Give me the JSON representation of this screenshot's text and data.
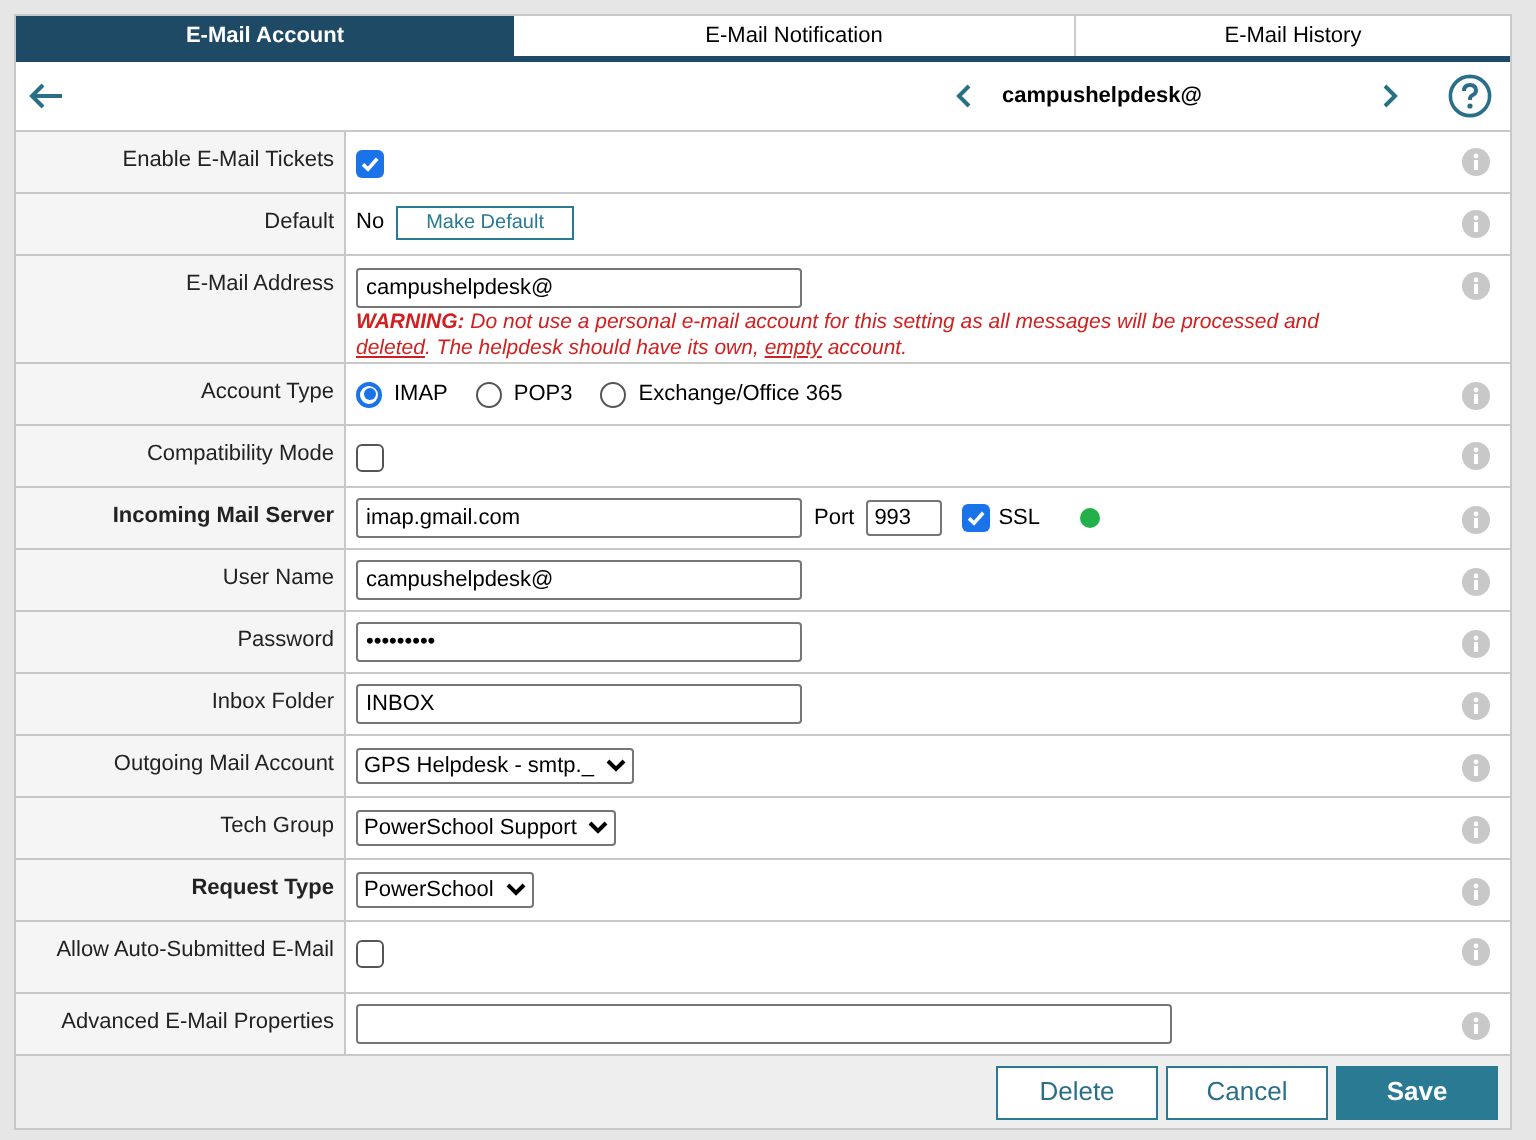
{
  "tabs": [
    {
      "label": "E-Mail Account",
      "selected": true
    },
    {
      "label": "E-Mail Notification",
      "selected": false
    },
    {
      "label": "E-Mail History",
      "selected": false
    }
  ],
  "header": {
    "title": "campushelpdesk@"
  },
  "rows": [
    {
      "kind": "checkbox",
      "label": "Enable E-Mail Tickets",
      "bold": false,
      "checked": true
    },
    {
      "kind": "default",
      "label": "Default",
      "bold": false,
      "value": "No",
      "button": "Make Default"
    },
    {
      "kind": "input",
      "label": "E-Mail Address",
      "bold": false,
      "value": "campushelpdesk@",
      "warning": [
        {
          "text": "WARNING:",
          "kind": "strong"
        },
        {
          "text": " Do not use a personal e-mail account for this setting as all messages will be processed and ",
          "kind": "plain"
        },
        {
          "text": "deleted",
          "kind": "underline"
        },
        {
          "text": ". The helpdesk should have its own, ",
          "kind": "plain"
        },
        {
          "text": "empty",
          "kind": "underline"
        },
        {
          "text": " account.",
          "kind": "plain"
        }
      ]
    },
    {
      "kind": "radio",
      "label": "Account Type",
      "bold": false,
      "options": [
        {
          "label": "IMAP",
          "selected": true
        },
        {
          "label": "POP3",
          "selected": false
        },
        {
          "label": "Exchange/Office 365",
          "selected": false
        }
      ]
    },
    {
      "kind": "checkbox",
      "label": "Compatibility Mode",
      "bold": false,
      "checked": false
    },
    {
      "kind": "server",
      "label": "Incoming Mail Server",
      "bold": true,
      "value": "imap.gmail.com",
      "port_label": "Port",
      "port": "993",
      "ssl_label": "SSL",
      "ssl": true,
      "connected": true
    },
    {
      "kind": "input",
      "label": "User Name",
      "bold": false,
      "value": "campushelpdesk@"
    },
    {
      "kind": "input",
      "label": "Password",
      "bold": false,
      "value": "•••••••••"
    },
    {
      "kind": "input",
      "label": "Inbox Folder",
      "bold": false,
      "value": "INBOX"
    },
    {
      "kind": "select",
      "label": "Outgoing Mail Account",
      "bold": false,
      "value": "GPS Helpdesk - smtp._"
    },
    {
      "kind": "select",
      "label": "Tech Group",
      "bold": false,
      "value": "PowerSchool Support"
    },
    {
      "kind": "select",
      "label": "Request Type",
      "bold": true,
      "value": "PowerSchool"
    },
    {
      "kind": "checkbox",
      "label": "Allow Auto-Submitted E-Mail",
      "bold": false,
      "checked": false
    },
    {
      "kind": "input",
      "label": "Advanced E-Mail Properties",
      "bold": false,
      "value": "",
      "wide": true
    }
  ],
  "buttons": [
    {
      "label": "Delete",
      "kind": "secondary"
    },
    {
      "label": "Cancel",
      "kind": "secondary"
    },
    {
      "label": "Save",
      "kind": "primary"
    }
  ]
}
